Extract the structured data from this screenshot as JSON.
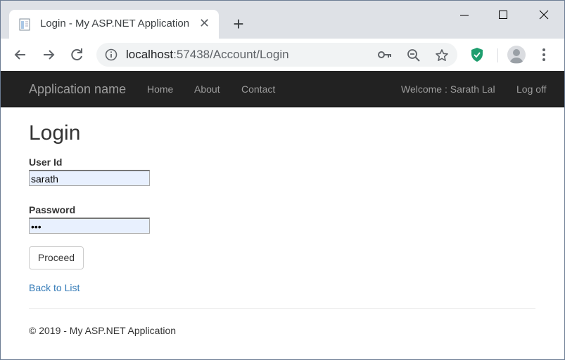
{
  "browser": {
    "tab_title": "Login - My ASP.NET Application",
    "url_host": "localhost",
    "url_rest": ":57438/Account/Login"
  },
  "navbar": {
    "brand": "Application name",
    "links": [
      "Home",
      "About",
      "Contact"
    ],
    "welcome": "Welcome : Sarath Lal",
    "logoff": "Log off"
  },
  "form": {
    "title": "Login",
    "userid_label": "User Id",
    "userid_value": "sarath",
    "password_label": "Password",
    "password_value": "•••",
    "submit_label": "Proceed",
    "back_link": "Back to List"
  },
  "footer": {
    "text": "© 2019 - My ASP.NET Application"
  },
  "colors": {
    "navbar_bg": "#222222",
    "nav_text": "#9d9d9d",
    "link": "#337ab7",
    "autofill_bg": "#e8f0fe"
  }
}
